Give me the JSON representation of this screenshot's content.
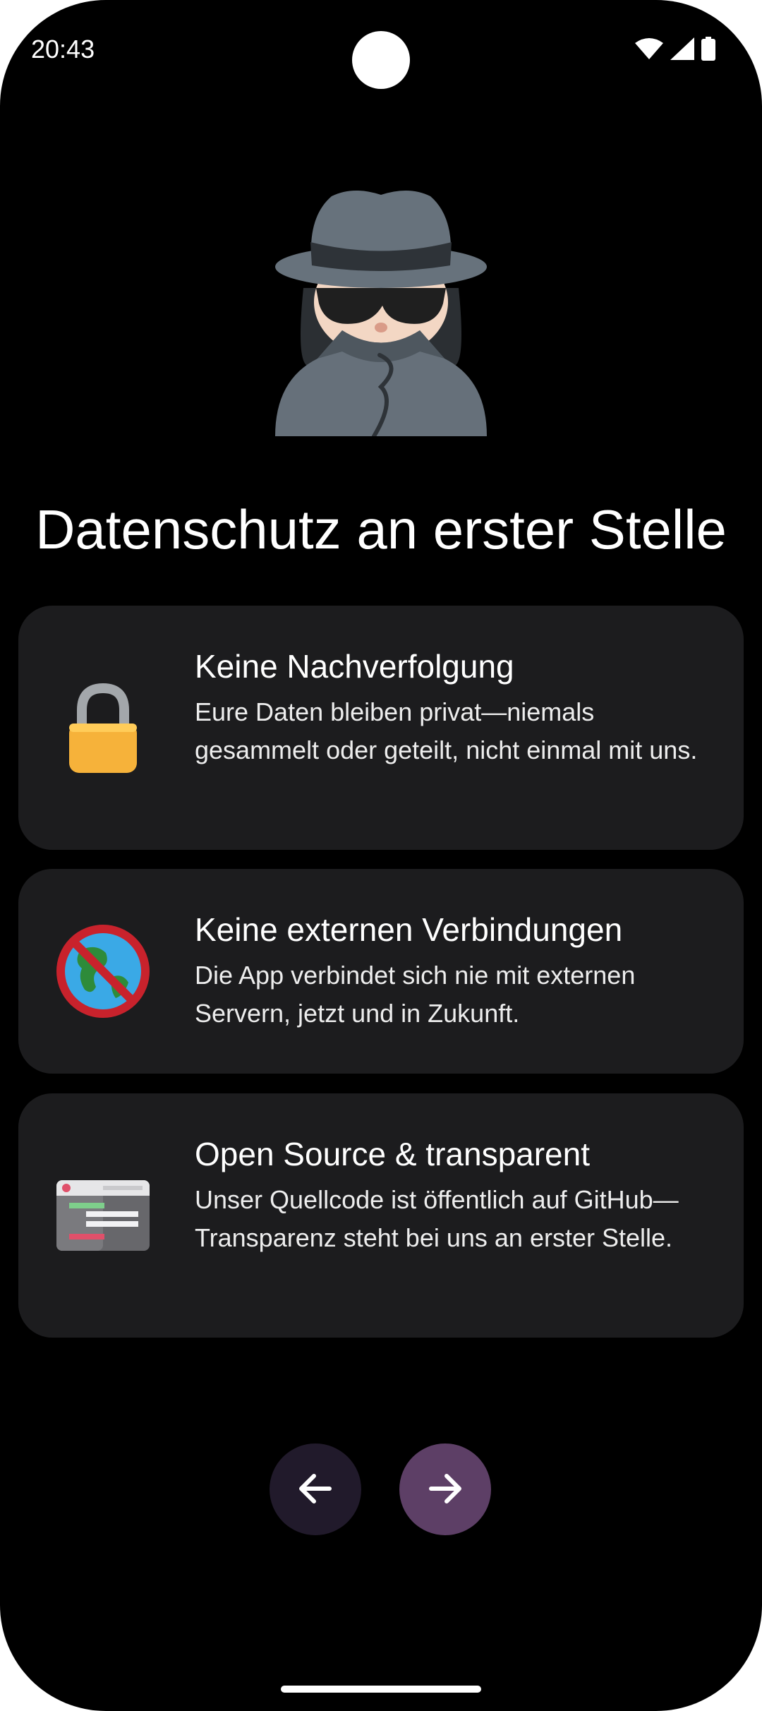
{
  "status_bar": {
    "time": "20:43",
    "icons": [
      "wifi-icon",
      "cellular-signal-icon",
      "battery-icon"
    ]
  },
  "hero": {
    "icon": "detective-icon"
  },
  "title": "Datenschutz an erster Stelle",
  "cards": [
    {
      "icon": "padlock-icon",
      "title": "Keine Nachverfolgung",
      "description": "Eure Daten bleiben privat—niemals gesammelt oder geteilt, nicht einmal mit uns."
    },
    {
      "icon": "no-globe-icon",
      "title": "Keine externen Verbindungen",
      "description": "Die App verbindet sich nie mit externen Servern, jetzt und in Zukunft."
    },
    {
      "icon": "code-window-icon",
      "title": "Open Source & transparent",
      "description": "Unser Quellcode ist öffentlich auf GitHub—Transparenz steht bei uns an erster Stelle."
    }
  ],
  "navigation": {
    "back_icon": "arrow-left-icon",
    "next_icon": "arrow-right-icon"
  },
  "colors": {
    "background": "#000000",
    "card": "#1c1c1e",
    "back_button": "#211a2b",
    "next_button": "#5d3f66"
  }
}
